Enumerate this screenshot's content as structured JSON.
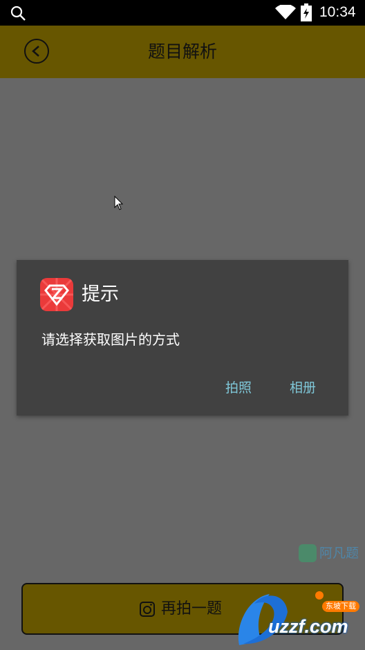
{
  "status_bar": {
    "time": "10:34",
    "icons": [
      "search-icon",
      "wifi-icon",
      "battery-icon"
    ]
  },
  "title_bar": {
    "title": "题目解析",
    "back_icon": "back-arrow-icon"
  },
  "dialog": {
    "icon": "app-logo-icon",
    "title": "提示",
    "message": "请选择获取图片的方式",
    "buttons": {
      "camera": "拍照",
      "album": "相册"
    }
  },
  "watermark": {
    "text": "阿凡题",
    "icon": "afanti-logo-icon"
  },
  "bottom": {
    "retake_label": "再拍一题",
    "icon": "camera-icon"
  },
  "corner_logo": {
    "text": "uzzf.com",
    "sub": "东坡下载"
  },
  "colors": {
    "title_bar": "#675600",
    "overlay": "#676767",
    "dialog_bg": "#414141",
    "dialog_button": "#7fc7d8"
  }
}
